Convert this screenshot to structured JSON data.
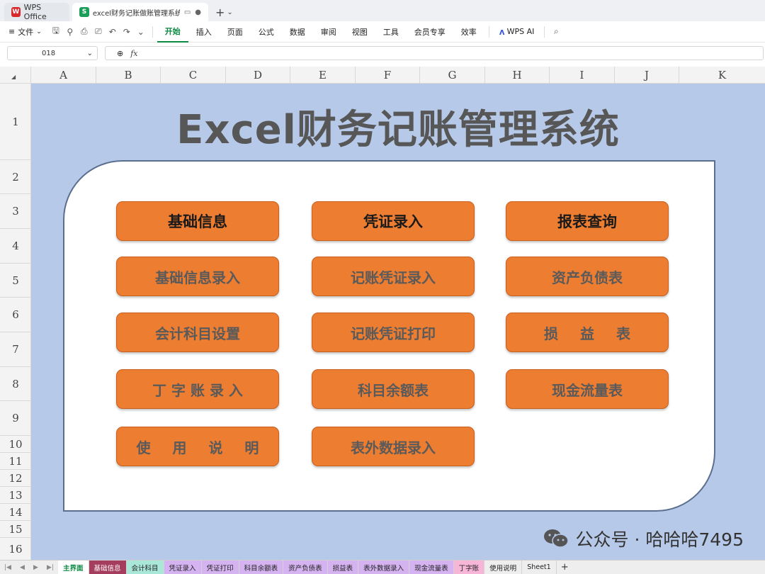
{
  "tabs": {
    "wps_office": "WPS Office",
    "document": "excel财务记账做账管理系统",
    "new_tab": "+",
    "dropdown": "⌄"
  },
  "menu": {
    "file": "文件",
    "items": [
      "开始",
      "插入",
      "页面",
      "公式",
      "数据",
      "审阅",
      "视图",
      "工具",
      "会员专享",
      "效率"
    ],
    "active_item": "开始",
    "wps_ai": "WPS AI"
  },
  "formula_bar": {
    "cell_ref": "018",
    "fx": "fx",
    "content": ""
  },
  "columns": [
    "A",
    "B",
    "C",
    "D",
    "E",
    "F",
    "G",
    "H",
    "I",
    "J",
    "K"
  ],
  "rows": [
    "1",
    "2",
    "3",
    "4",
    "5",
    "6",
    "7",
    "8",
    "9",
    "10",
    "11",
    "12",
    "13",
    "14",
    "15",
    "16"
  ],
  "dashboard": {
    "title": "Excel财务记账管理系统",
    "column_heads": [
      "基础信息",
      "凭证录入",
      "报表查询"
    ],
    "col1": [
      "基础信息录入",
      "会计科目设置",
      "丁 字 账 录 入",
      "使 用 说 明"
    ],
    "col2": [
      "记账凭证录入",
      "记账凭证打印",
      "科目余额表",
      "表外数据录入"
    ],
    "col3": [
      "资产负债表",
      "损 益 表",
      "现金流量表"
    ],
    "button_color": "#ed7d31",
    "background_color": "#b7c9e8"
  },
  "watermark": {
    "text": "公众号 · 哈哈哈7495"
  },
  "sheets": [
    {
      "label": "主界面",
      "color": "#ffffff",
      "text_color": "#0c8a43"
    },
    {
      "label": "基础信息",
      "color": "#a43d5e",
      "text_color": "#ffffff"
    },
    {
      "label": "会计科目",
      "color": "#a9e8d8",
      "text_color": "#222222"
    },
    {
      "label": "凭证录入",
      "color": "#d4b3f0",
      "text_color": "#222222"
    },
    {
      "label": "凭证打印",
      "color": "#d4b3f0",
      "text_color": "#222222"
    },
    {
      "label": "科目余额表",
      "color": "#d4b3f0",
      "text_color": "#222222"
    },
    {
      "label": "资产负债表",
      "color": "#d4b3f0",
      "text_color": "#222222"
    },
    {
      "label": "损益表",
      "color": "#d4b3f0",
      "text_color": "#222222"
    },
    {
      "label": "表外数据录入",
      "color": "#d4b3f0",
      "text_color": "#222222"
    },
    {
      "label": "现金流量表",
      "color": "#d4b3f0",
      "text_color": "#222222"
    },
    {
      "label": "丁字账",
      "color": "#f7b6d8",
      "text_color": "#222222"
    },
    {
      "label": "使用说明",
      "color": "#eeeeee",
      "text_color": "#222222"
    },
    {
      "label": "Sheet1",
      "color": "#eeeeee",
      "text_color": "#222222"
    }
  ]
}
